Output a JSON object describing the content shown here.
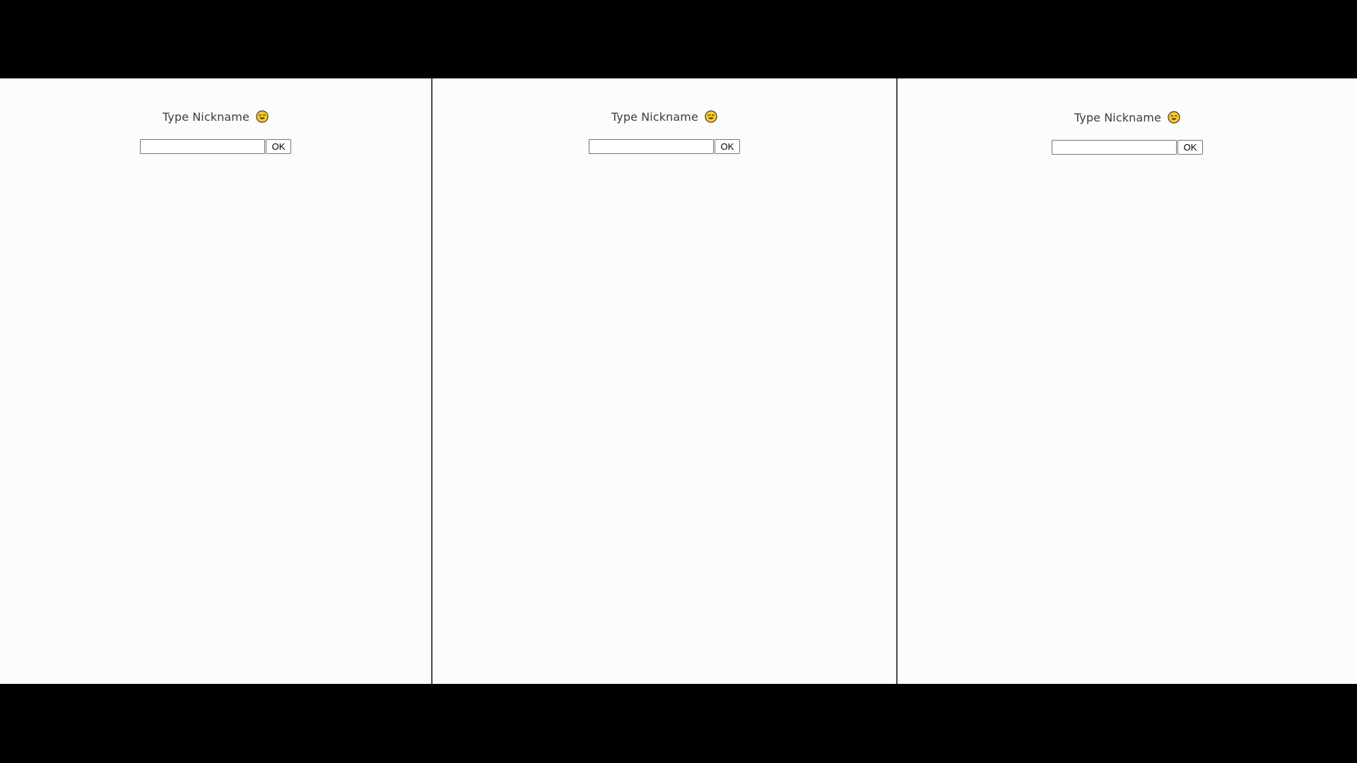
{
  "panels": [
    {
      "prompt": "Type Nickname",
      "emoji_icon": "smiling-face-icon",
      "input_value": "",
      "button_label": "OK"
    },
    {
      "prompt": "Type Nickname",
      "emoji_icon": "smiling-face-icon",
      "input_value": "",
      "button_label": "OK"
    },
    {
      "prompt": "Type Nickname",
      "emoji_icon": "smiling-face-icon",
      "input_value": "",
      "button_label": "OK"
    }
  ],
  "colors": {
    "letterbox": "#000000",
    "panel_background": "#fcfcfe",
    "divider": "#4a4a4a",
    "emoji_face": "#f7c531",
    "text": "#3c3c3c"
  }
}
